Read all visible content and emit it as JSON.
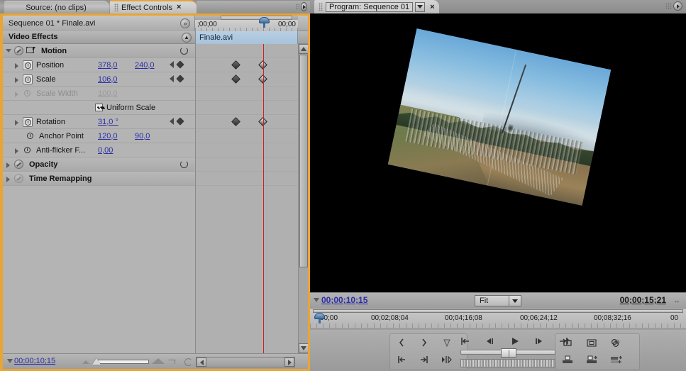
{
  "left_panel": {
    "tabs": [
      {
        "label": "Source: (no clips)",
        "active": false
      },
      {
        "label": "Effect Controls",
        "active": true,
        "close": "×"
      }
    ],
    "sequence_header": "Sequence 01 * Finale.avi",
    "section_title": "Video Effects",
    "clip_name": "Finale.avi",
    "ruler": {
      "start_tc": ";00;00",
      "end_tc": "00;00"
    },
    "properties": [
      {
        "name": "Motion",
        "type": "group",
        "bold": true,
        "expanded": true
      },
      {
        "name": "Position",
        "v1": "378,0",
        "v2": "240,0",
        "stopwatch": true,
        "keyframes": true
      },
      {
        "name": "Scale",
        "v1": "106,0",
        "v2": "",
        "stopwatch": true,
        "keyframes": true
      },
      {
        "name": "Scale Width",
        "v1": "100,0",
        "v2": "",
        "disabled": true
      },
      {
        "name": "Uniform Scale",
        "type": "checkbox",
        "checked": true
      },
      {
        "name": "Rotation",
        "v1": "31,0 °",
        "v2": "",
        "stopwatch": true,
        "keyframes": true
      },
      {
        "name": "Anchor Point",
        "v1": "120,0",
        "v2": "90,0"
      },
      {
        "name": "Anti-flicker F...",
        "v1": "0,00",
        "v2": ""
      },
      {
        "name": "Opacity",
        "type": "group",
        "bold": true,
        "expanded": false
      },
      {
        "name": "Time Remapping",
        "type": "group",
        "bold": true,
        "expanded": false,
        "disabled": true
      }
    ],
    "footer": {
      "timecode": "00;00;10;15"
    }
  },
  "right_panel": {
    "tab": {
      "label": "Program: Sequence 01",
      "close": "×"
    },
    "current_timecode": "00;00;10;15",
    "zoom_level": "Fit",
    "duration_timecode": "00;00;15;21",
    "resize_glyph": "↔",
    "ruler_labels": [
      {
        "text": "00;00",
        "pos": 14
      },
      {
        "text": "00;02;08;04",
        "pos": 86
      },
      {
        "text": "00;04;16;08",
        "pos": 190
      },
      {
        "text": "00;06;24;12",
        "pos": 296
      },
      {
        "text": "00;08;32;16",
        "pos": 400
      },
      {
        "text": "00",
        "pos": 506
      }
    ],
    "transport_buttons": [
      "set-in-point",
      "set-out-point",
      "set-marker",
      "go-to-in-point",
      "go-to-out-point",
      "play-in-to-out",
      "step-back-jump",
      "step-back",
      "play-stop",
      "step-forward",
      "step-forward-jump",
      "export-frame",
      "safe-margins",
      "output-settings",
      "lift",
      "extract",
      "insert-overlay"
    ]
  },
  "colors": {
    "accent_orange": "#e9a533",
    "value_blue": "#2b2fa8",
    "playhead_red": "#cc2222",
    "panel_grey": "#b4b4b4"
  }
}
